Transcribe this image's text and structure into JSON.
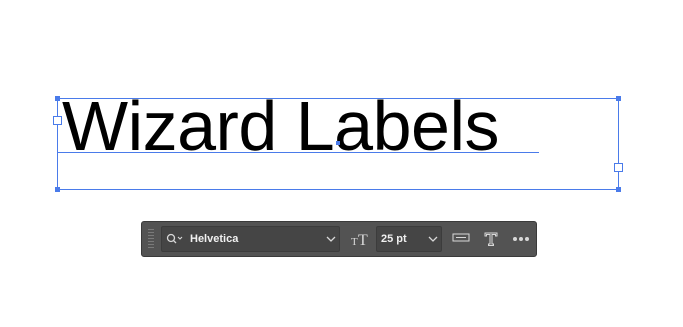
{
  "artboard": {
    "text_frame": {
      "content": "Wizard Labels"
    }
  },
  "toolbar": {
    "font_family": {
      "value": "Helvetica"
    },
    "font_size": {
      "value": "25 pt"
    },
    "icons": {
      "search": "search-icon",
      "font_dropdown": "chevron-down-icon",
      "font_size": "font-size-icon",
      "size_dropdown": "chevron-down-icon",
      "paragraph": "paragraph-align-icon",
      "type_tool": "type-tool-icon",
      "more": "more-options-icon"
    }
  },
  "colors": {
    "selection": "#4a7bea",
    "toolbar_bg": "#535353",
    "field_bg": "#454545",
    "text": "#000000"
  }
}
